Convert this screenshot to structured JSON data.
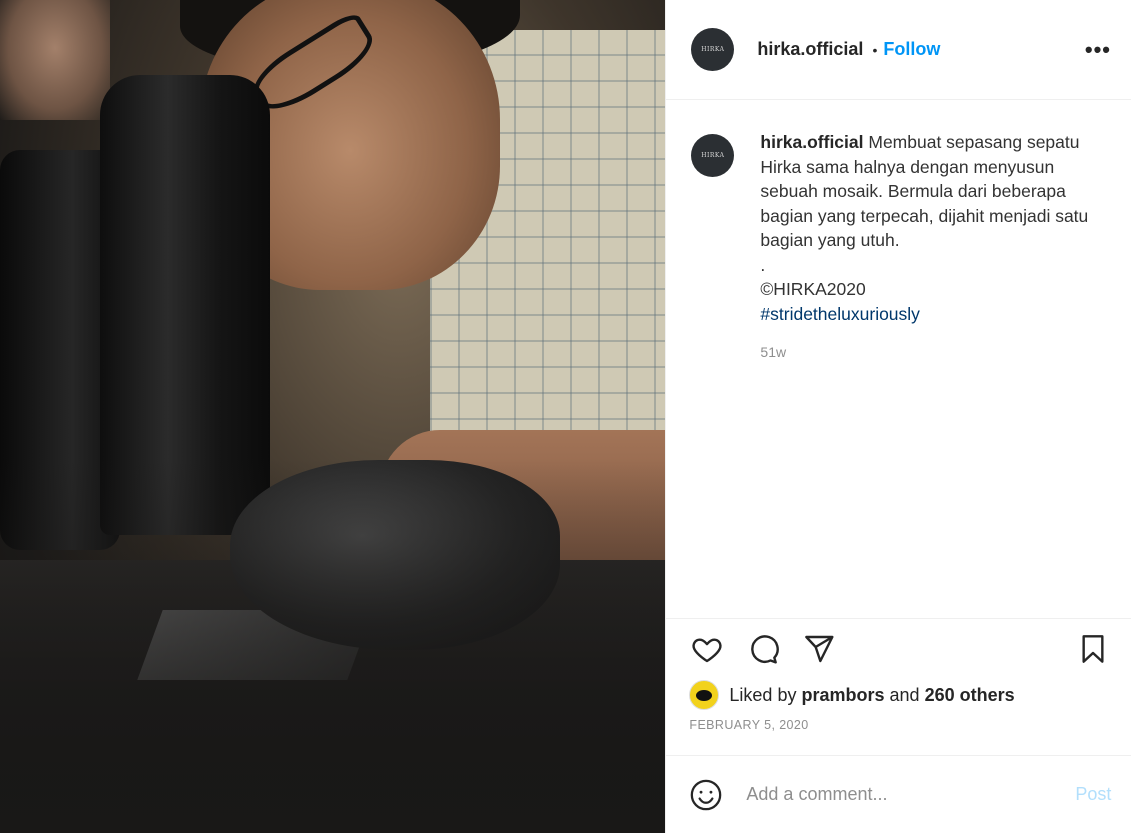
{
  "post": {
    "image_alt": "",
    "author": {
      "username": "hirka.official",
      "avatar_text": "HIRKA"
    },
    "header": {
      "separator": "•",
      "follow_label": "Follow",
      "more_label": "•••"
    },
    "caption": {
      "username": "hirka.official",
      "text": "Membuat sepasang sepatu Hirka sama halnya dengan menyusun sebuah mosaik. Bermula dari beberapa bagian yang terpecah, dijahit menjadi satu bagian yang utuh.",
      "dot_line": ".",
      "copyright": "©HIRKA2020",
      "hashtag": "#stridetheluxuriously",
      "age": "51w"
    },
    "actions": {
      "like_icon": "heart-icon",
      "comment_icon": "comment-icon",
      "share_icon": "paper-plane-icon",
      "save_icon": "bookmark-icon"
    },
    "likes": {
      "prefix": "Liked by",
      "first_liker": "prambors",
      "connector": "and",
      "others": "260 others"
    },
    "date": "FEBRUARY 5, 2020",
    "comment": {
      "placeholder": "Add a comment...",
      "post_label": "Post",
      "emoji_icon": "smiley-icon"
    },
    "colors": {
      "link_blue": "#0095f6",
      "hashtag_blue": "#00376b",
      "post_disabled": "#b2dffc",
      "meta_gray": "#8e8e8e"
    }
  }
}
